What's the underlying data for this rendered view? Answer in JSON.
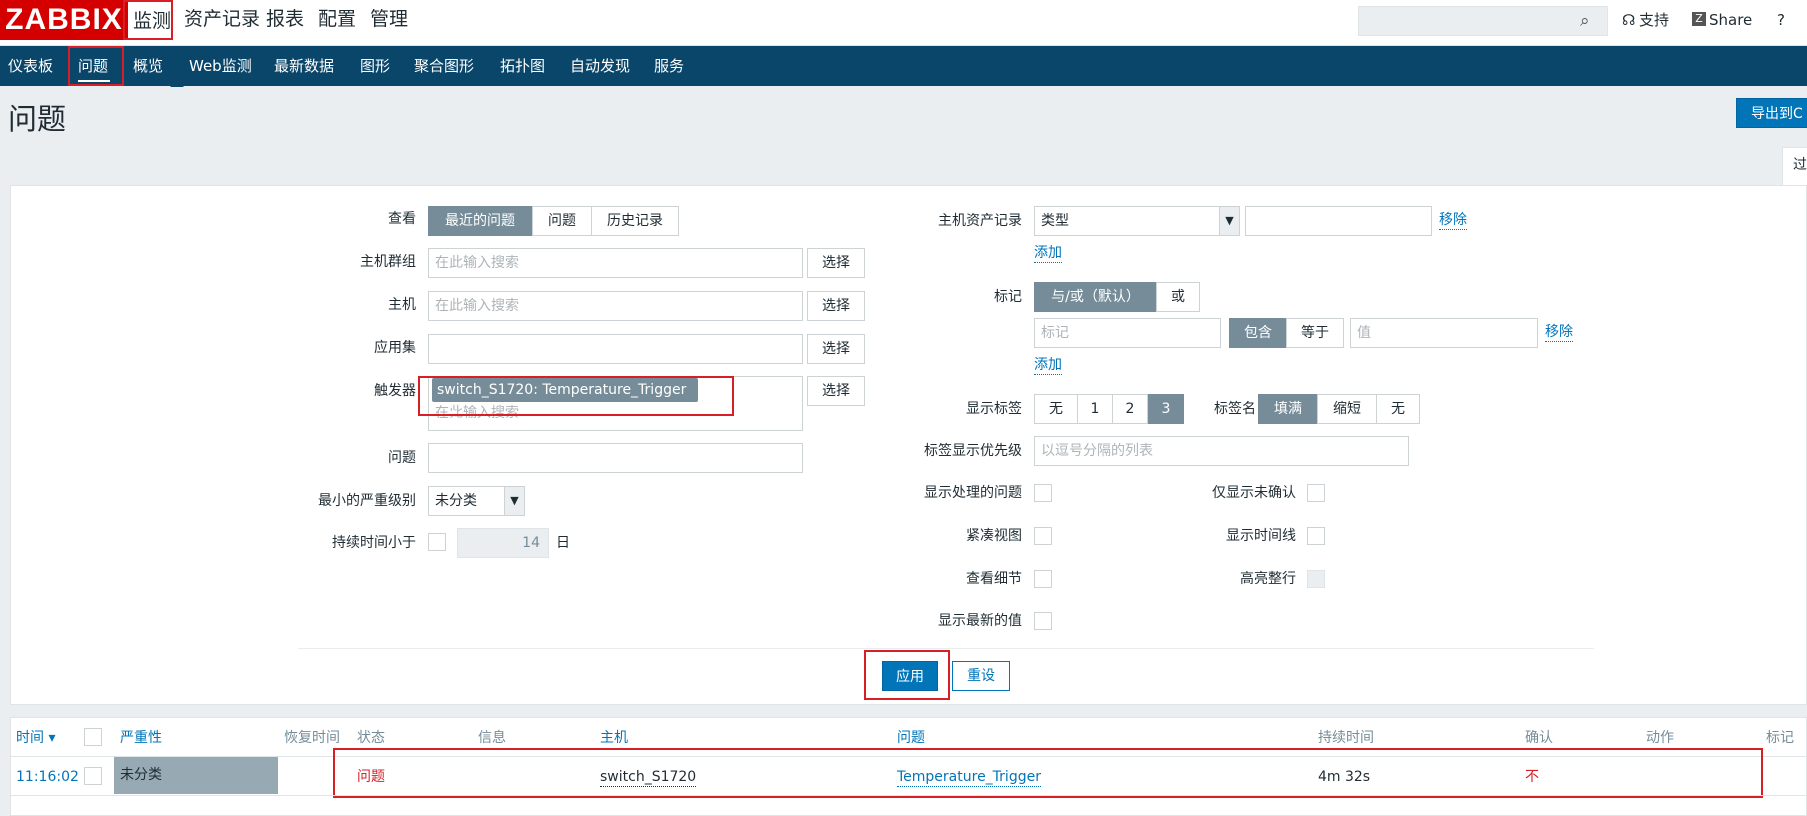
{
  "logo": "ZABBIX",
  "top_menu": [
    "监测",
    "资产记录",
    "报表",
    "配置",
    "管理"
  ],
  "top_links": {
    "support": "支持",
    "share": "Share",
    "help": "?"
  },
  "search": {
    "value": "",
    "placeholder": ""
  },
  "nav": [
    "仪表板",
    "问题",
    "概览",
    "Web监测",
    "最新数据",
    "图形",
    "聚合图形",
    "拓扑图",
    "自动发现",
    "服务"
  ],
  "page": {
    "title": "问题",
    "export": "导出到C",
    "filter_tab": "过"
  },
  "filter": {
    "view_label": "查看",
    "view_options": [
      "最近的问题",
      "问题",
      "历史记录"
    ],
    "hostgroup_label": "主机群组",
    "host_label": "主机",
    "app_label": "应用集",
    "trigger_label": "触发器",
    "problem_label": "问题",
    "severity_label": "最小的严重级别",
    "duration_label": "持续时间小于",
    "placeholder_search": "在此输入搜索",
    "select_btn": "选择",
    "trigger_chip": "switch_S1720: Temperature_Trigger",
    "chip_remove": "✖",
    "severity_value": "未分类",
    "duration_value": "14",
    "duration_unit": "日",
    "inventory_label": "主机资产记录",
    "inventory_type": "类型",
    "remove": "移除",
    "add": "添加",
    "tags_label": "标记",
    "tags_ops": [
      "与/或（默认）",
      "或"
    ],
    "tag_placeholder": "标记",
    "tag_match": [
      "包含",
      "等于"
    ],
    "value_placeholder": "值",
    "show_tags_label": "显示标签",
    "show_tags_options": [
      "无",
      "1",
      "2",
      "3"
    ],
    "tag_name_label": "标签名",
    "tag_name_options": [
      "填满",
      "缩短",
      "无"
    ],
    "tag_priority_label": "标签显示优先级",
    "tag_priority_placeholder": "以逗号分隔的列表",
    "show_suppressed": "显示处理的问题",
    "only_unack": "仅显示未确认",
    "compact_view": "紧凑视图",
    "show_timeline": "显示时间线",
    "details": "查看细节",
    "highlight_row": "高亮整行",
    "latest_values": "显示最新的值",
    "apply": "应用",
    "reset": "重设"
  },
  "table": {
    "headers": {
      "time": "时间 ▾",
      "severity": "严重性",
      "recovery": "恢复时间",
      "status": "状态",
      "info": "信息",
      "host": "主机",
      "problem": "问题",
      "duration": "持续时间",
      "ack": "确认",
      "actions": "动作",
      "tags": "标记"
    },
    "rows": [
      {
        "time": "11:16:02",
        "severity": "未分类",
        "status": "问题",
        "host": "switch_S1720",
        "problem": "Temperature_Trigger",
        "duration": "4m 32s",
        "ack": "不"
      }
    ]
  }
}
